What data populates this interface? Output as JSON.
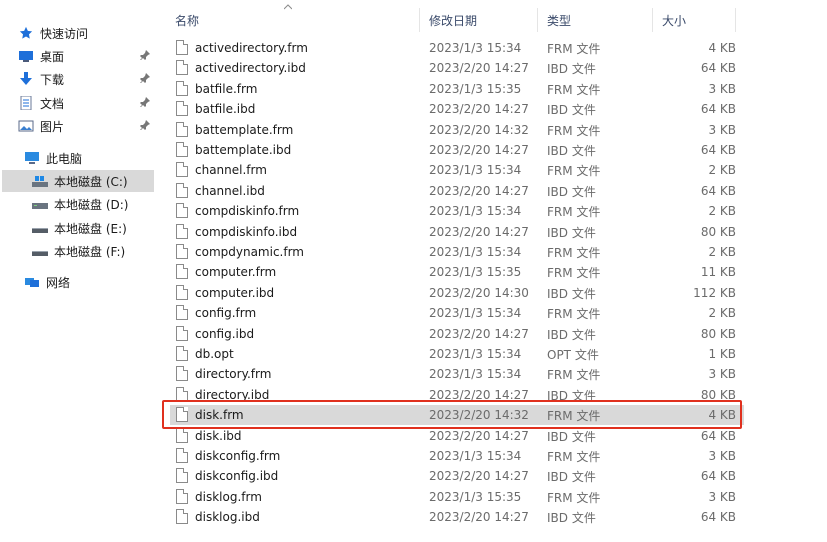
{
  "nav": {
    "items": [
      {
        "label": "快速访问",
        "icon": "star-icon",
        "pinned": false
      },
      {
        "label": "桌面",
        "icon": "desktop-icon",
        "pinned": true
      },
      {
        "label": "下载",
        "icon": "download-icon",
        "pinned": true
      },
      {
        "label": "文档",
        "icon": "document-icon",
        "pinned": true
      },
      {
        "label": "图片",
        "icon": "pictures-icon",
        "pinned": true
      },
      {
        "label": "此电脑",
        "icon": "computer-icon",
        "pinned": false
      },
      {
        "label": "本地磁盘 (C:)",
        "icon": "system-drive-icon",
        "pinned": false
      },
      {
        "label": "本地磁盘 (D:)",
        "icon": "drive-icon",
        "pinned": false
      },
      {
        "label": "本地磁盘 (E:)",
        "icon": "drive-icon",
        "pinned": false
      },
      {
        "label": "本地磁盘 (F:)",
        "icon": "drive-icon",
        "pinned": false
      },
      {
        "label": "网络",
        "icon": "network-icon",
        "pinned": false
      }
    ]
  },
  "columns": {
    "name": "名称",
    "date": "修改日期",
    "type": "类型",
    "size": "大小"
  },
  "files": [
    {
      "name": "activedirectory.frm",
      "date": "2023/1/3 15:34",
      "type": "FRM 文件",
      "size": "4 KB"
    },
    {
      "name": "activedirectory.ibd",
      "date": "2023/2/20 14:27",
      "type": "IBD 文件",
      "size": "64 KB"
    },
    {
      "name": "batfile.frm",
      "date": "2023/1/3 15:35",
      "type": "FRM 文件",
      "size": "3 KB"
    },
    {
      "name": "batfile.ibd",
      "date": "2023/2/20 14:27",
      "type": "IBD 文件",
      "size": "64 KB"
    },
    {
      "name": "battemplate.frm",
      "date": "2023/2/20 14:32",
      "type": "FRM 文件",
      "size": "3 KB"
    },
    {
      "name": "battemplate.ibd",
      "date": "2023/2/20 14:27",
      "type": "IBD 文件",
      "size": "64 KB"
    },
    {
      "name": "channel.frm",
      "date": "2023/1/3 15:34",
      "type": "FRM 文件",
      "size": "2 KB"
    },
    {
      "name": "channel.ibd",
      "date": "2023/2/20 14:27",
      "type": "IBD 文件",
      "size": "64 KB"
    },
    {
      "name": "compdiskinfo.frm",
      "date": "2023/1/3 15:34",
      "type": "FRM 文件",
      "size": "2 KB"
    },
    {
      "name": "compdiskinfo.ibd",
      "date": "2023/2/20 14:27",
      "type": "IBD 文件",
      "size": "80 KB"
    },
    {
      "name": "compdynamic.frm",
      "date": "2023/1/3 15:34",
      "type": "FRM 文件",
      "size": "2 KB"
    },
    {
      "name": "computer.frm",
      "date": "2023/1/3 15:35",
      "type": "FRM 文件",
      "size": "11 KB"
    },
    {
      "name": "computer.ibd",
      "date": "2023/2/20 14:30",
      "type": "IBD 文件",
      "size": "112 KB"
    },
    {
      "name": "config.frm",
      "date": "2023/1/3 15:34",
      "type": "FRM 文件",
      "size": "2 KB"
    },
    {
      "name": "config.ibd",
      "date": "2023/2/20 14:27",
      "type": "IBD 文件",
      "size": "80 KB"
    },
    {
      "name": "db.opt",
      "date": "2023/1/3 15:34",
      "type": "OPT 文件",
      "size": "1 KB"
    },
    {
      "name": "directory.frm",
      "date": "2023/1/3 15:34",
      "type": "FRM 文件",
      "size": "3 KB"
    },
    {
      "name": "directory.ibd",
      "date": "2023/2/20 14:27",
      "type": "IBD 文件",
      "size": "80 KB"
    },
    {
      "name": "disk.frm",
      "date": "2023/2/20 14:32",
      "type": "FRM 文件",
      "size": "4 KB",
      "selected": true
    },
    {
      "name": "disk.ibd",
      "date": "2023/2/20 14:27",
      "type": "IBD 文件",
      "size": "64 KB"
    },
    {
      "name": "diskconfig.frm",
      "date": "2023/1/3 15:34",
      "type": "FRM 文件",
      "size": "3 KB"
    },
    {
      "name": "diskconfig.ibd",
      "date": "2023/2/20 14:27",
      "type": "IBD 文件",
      "size": "64 KB"
    },
    {
      "name": "disklog.frm",
      "date": "2023/1/3 15:35",
      "type": "FRM 文件",
      "size": "3 KB"
    },
    {
      "name": "disklog.ibd",
      "date": "2023/2/20 14:27",
      "type": "IBD 文件",
      "size": "64 KB"
    }
  ],
  "colors": {
    "highlight_border": "#e0301e",
    "selection": "#d9d9d9",
    "accent": "#1e6fd9"
  }
}
